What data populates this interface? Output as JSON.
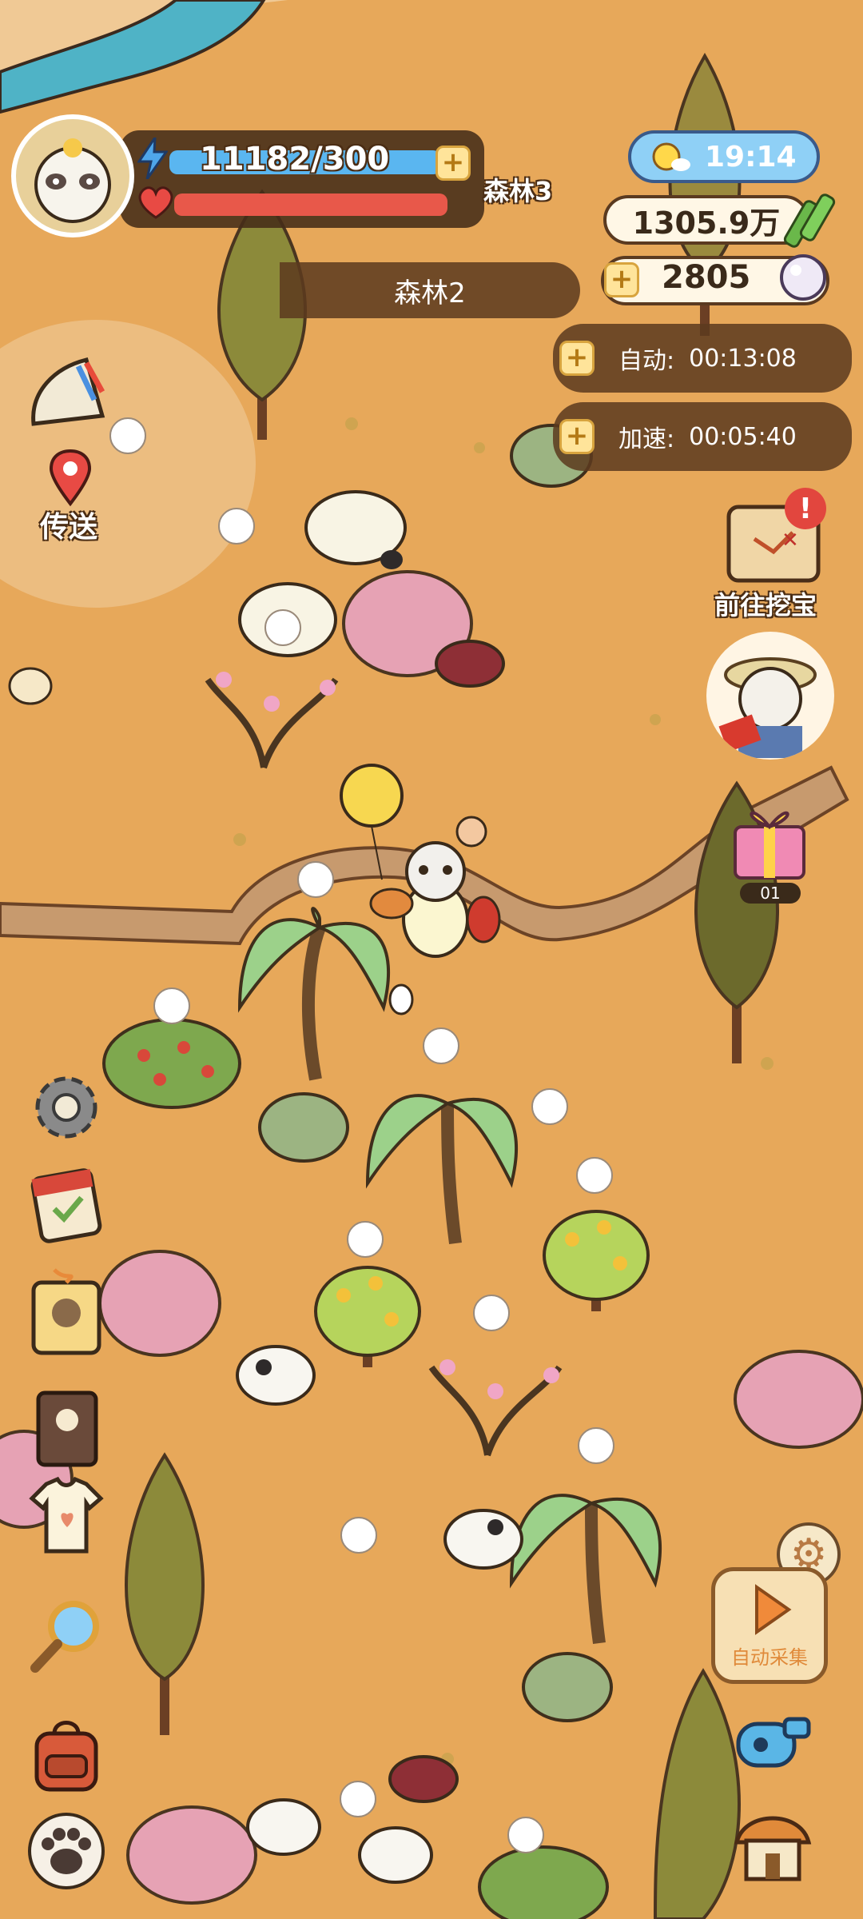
{
  "player": {
    "energy_text": "11182/300",
    "area_name_overlay": "森林3",
    "current_area": "森林2"
  },
  "hud": {
    "time": "19:14",
    "coins": "1305.9万",
    "pearls": "2805",
    "auto_label": "自动:",
    "auto_time": "00:13:08",
    "speed_label": "加速:",
    "speed_time": "00:05:40"
  },
  "left_menu": {
    "teleport_label": "传送"
  },
  "right_menu": {
    "treasure_label": "前往挖宝",
    "gift_count": "01",
    "auto_collect_label": "自动采集"
  },
  "colors": {
    "ground": "#e7a85a",
    "panel_bg": "#5c3a1e",
    "energy_blue": "#5ab6f0",
    "health_red": "#e8584a",
    "button_yellow": "#ffe49a",
    "river": "#4fb3c6"
  },
  "icons": [
    "lightning-icon",
    "heart-icon",
    "sun-cloud-icon",
    "bamboo-icon",
    "pearl-icon",
    "fan-icon",
    "map-pin-icon",
    "treasure-map-icon",
    "gift-icon",
    "gear-icon",
    "calendar-icon",
    "skull-tag-icon",
    "cookbook-icon",
    "shirt-icon",
    "magnifier-icon",
    "backpack-icon",
    "paw-icon",
    "play-icon",
    "whistle-icon",
    "house-icon"
  ]
}
